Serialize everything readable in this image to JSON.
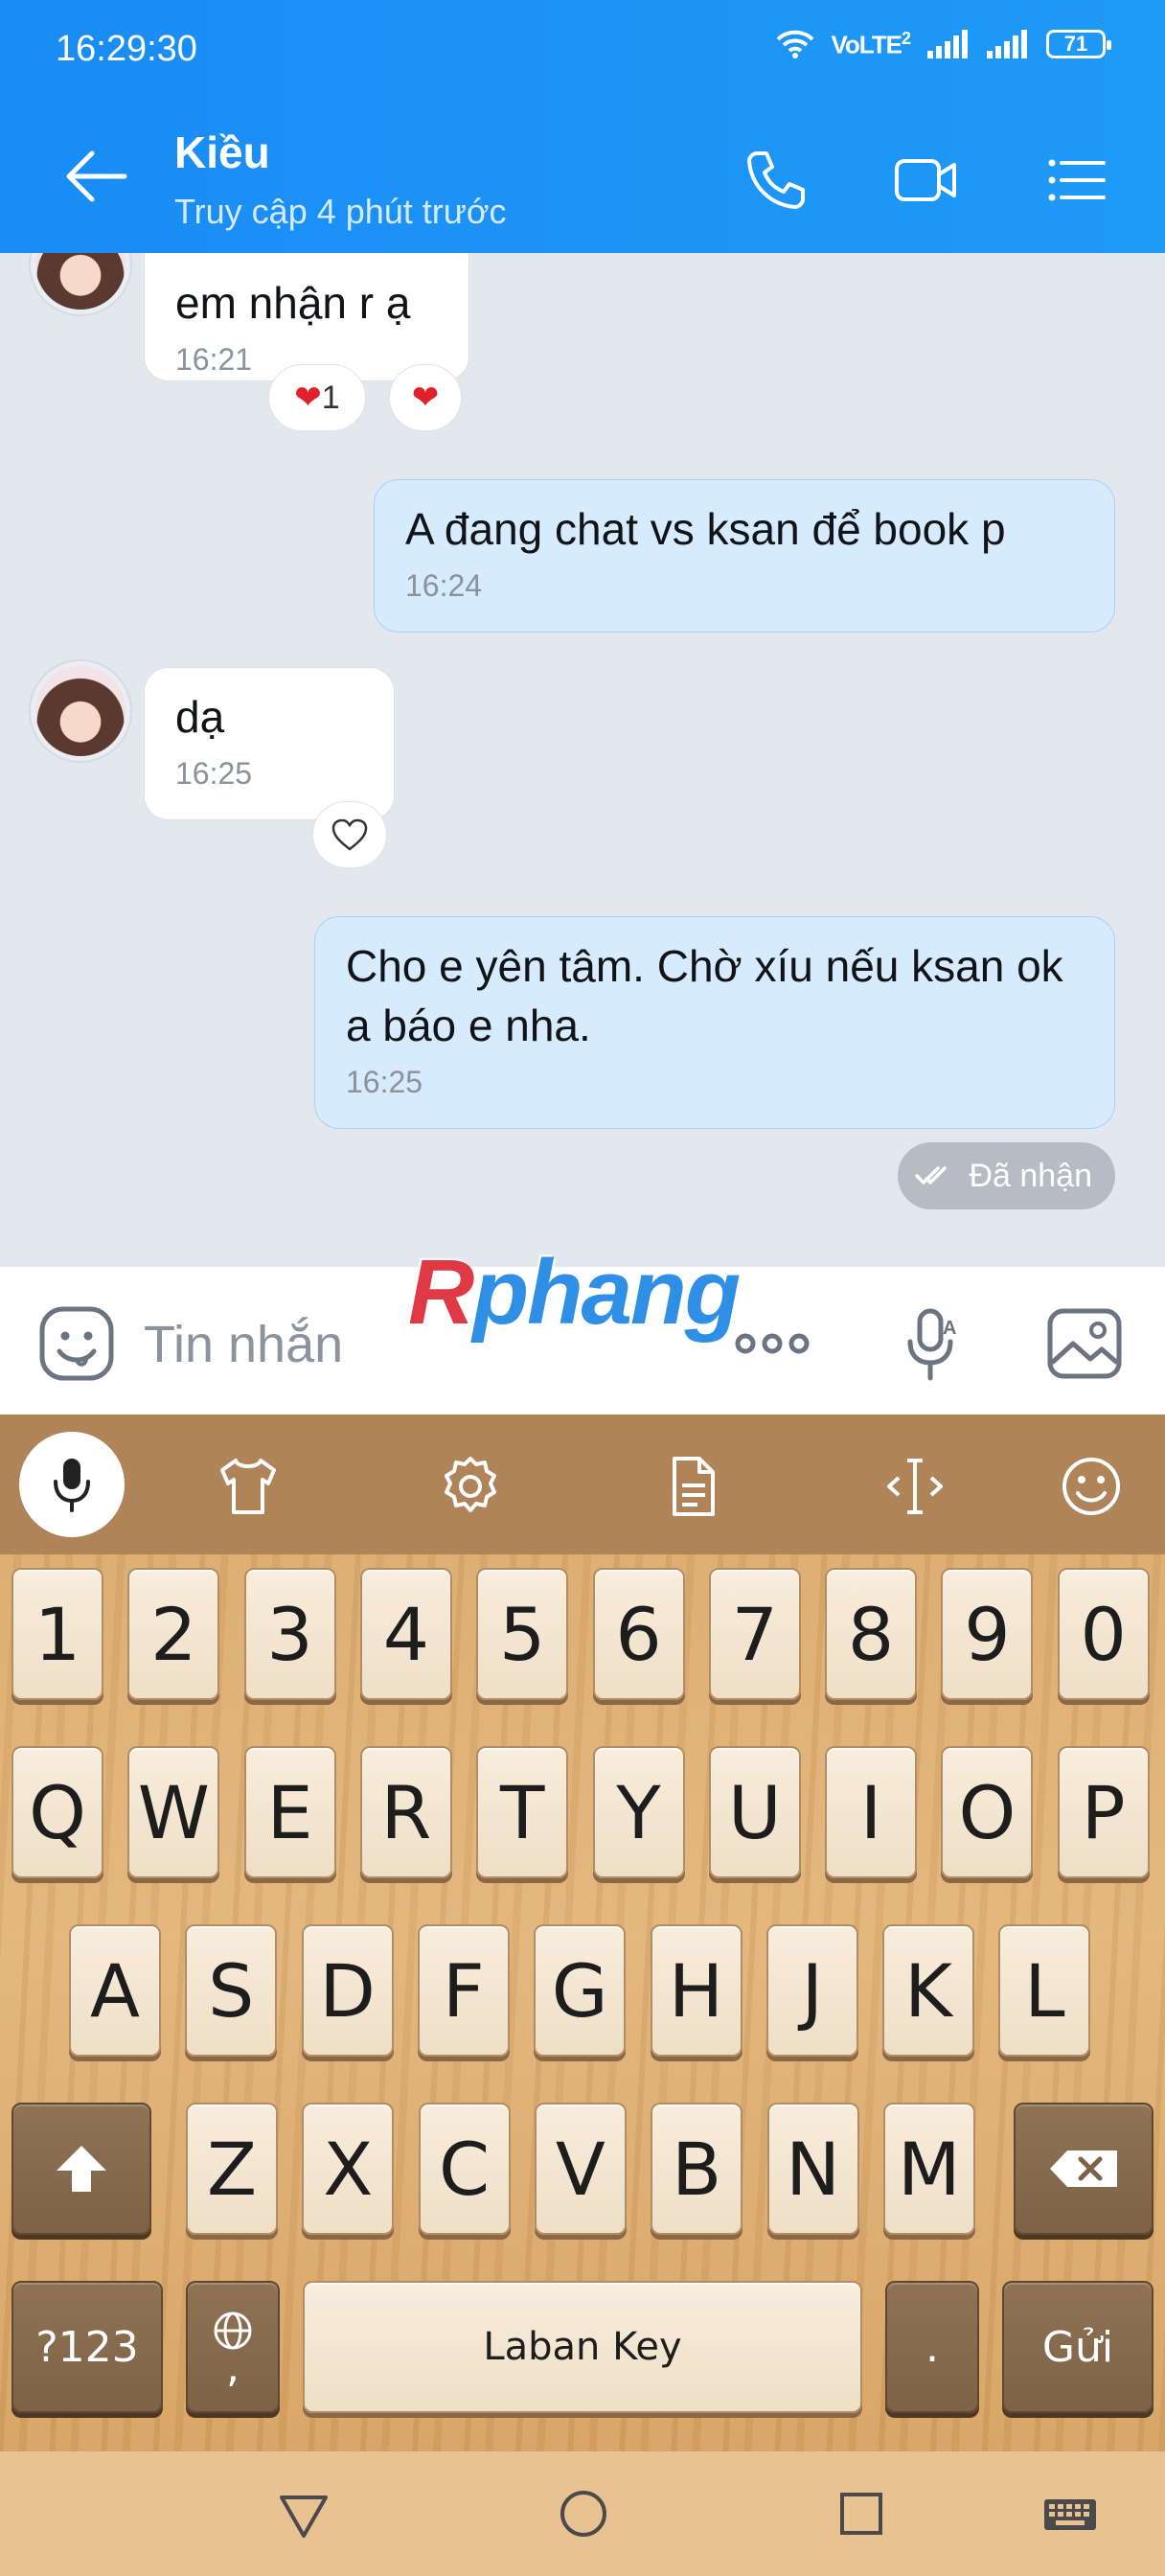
{
  "status_bar": {
    "time": "16:29:30",
    "network_label": "VoLTE",
    "sim_badge": "2",
    "battery": "71"
  },
  "header": {
    "contact_name": "Kiều",
    "last_seen": "Truy cập 4 phút trước"
  },
  "messages": [
    {
      "dir": "in",
      "text": "em nhận r ạ",
      "time": "16:21"
    },
    {
      "dir": "out",
      "text": "A đang chat vs ksan để book p",
      "time": "16:24"
    },
    {
      "dir": "in",
      "text": "dạ",
      "time": "16:25"
    },
    {
      "dir": "out",
      "text": "Cho e yên tâm. Chờ xíu nếu ksan ok a báo e nha.",
      "time": "16:25"
    }
  ],
  "reactions": {
    "count": "1"
  },
  "seen_status": "Đã nhận",
  "composer": {
    "placeholder": "Tin nhắn"
  },
  "watermark": {
    "part1": "R",
    "part2": "phang"
  },
  "keyboard": {
    "row_numbers": [
      "1",
      "2",
      "3",
      "4",
      "5",
      "6",
      "7",
      "8",
      "9",
      "0"
    ],
    "row1": [
      "Q",
      "W",
      "E",
      "R",
      "T",
      "Y",
      "U",
      "I",
      "O",
      "P"
    ],
    "row2": [
      "A",
      "S",
      "D",
      "F",
      "G",
      "H",
      "J",
      "K",
      "L"
    ],
    "row3": [
      "Z",
      "X",
      "C",
      "V",
      "B",
      "N",
      "M"
    ],
    "symbols_key": "?123",
    "comma_key": ",",
    "space_label": "Laban Key",
    "period_key": ".",
    "send_key": "Gửi"
  },
  "colors": {
    "header": "#1a8cf5",
    "outgoing_bubble": "#d6ebfd",
    "incoming_bubble": "#ffffff",
    "chat_bg": "#e3e7ee"
  }
}
